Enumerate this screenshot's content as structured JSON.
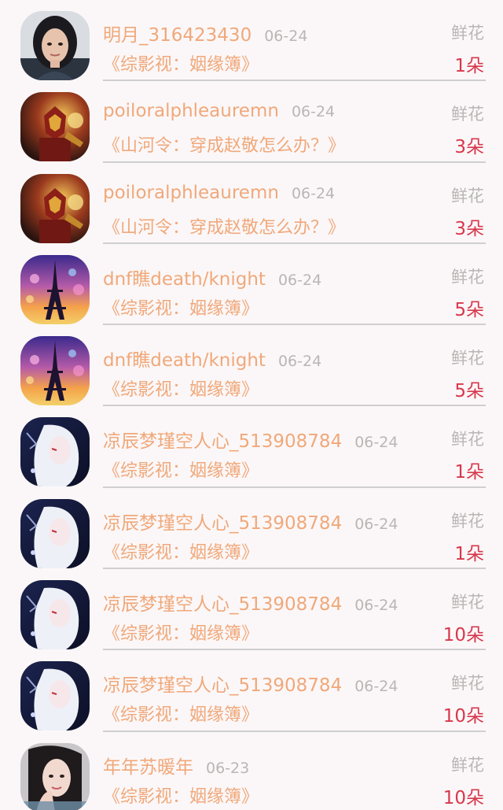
{
  "rows": [
    {
      "user": "明月_316423430",
      "date": "06-24",
      "gift": "鲜花",
      "book": "《综影视：姻缘簿》",
      "count": "1朵",
      "avatar": "woman-portrait"
    },
    {
      "user": "poiloralphleauremn",
      "date": "06-24",
      "gift": "鲜花",
      "book": "《山河令：穿成赵敬怎么办？》",
      "count": "3朵",
      "avatar": "armored-hero"
    },
    {
      "user": "poiloralphleauremn",
      "date": "06-24",
      "gift": "鲜花",
      "book": "《山河令：穿成赵敬怎么办？》",
      "count": "3朵",
      "avatar": "armored-hero"
    },
    {
      "user": "dnf瞧death/knight",
      "date": "06-24",
      "gift": "鲜花",
      "book": "《综影视：姻缘簿》",
      "count": "5朵",
      "avatar": "eiffel-tower"
    },
    {
      "user": "dnf瞧death/knight",
      "date": "06-24",
      "gift": "鲜花",
      "book": "《综影视：姻缘簿》",
      "count": "5朵",
      "avatar": "eiffel-tower"
    },
    {
      "user": "凉辰梦瑾空人心_513908784",
      "date": "06-24",
      "gift": "鲜花",
      "book": "《综影视：姻缘簿》",
      "count": "1朵",
      "avatar": "anime-white-hair"
    },
    {
      "user": "凉辰梦瑾空人心_513908784",
      "date": "06-24",
      "gift": "鲜花",
      "book": "《综影视：姻缘簿》",
      "count": "1朵",
      "avatar": "anime-white-hair"
    },
    {
      "user": "凉辰梦瑾空人心_513908784",
      "date": "06-24",
      "gift": "鲜花",
      "book": "《综影视：姻缘簿》",
      "count": "10朵",
      "avatar": "anime-white-hair"
    },
    {
      "user": "凉辰梦瑾空人心_513908784",
      "date": "06-24",
      "gift": "鲜花",
      "book": "《综影视：姻缘簿》",
      "count": "10朵",
      "avatar": "anime-white-hair"
    },
    {
      "user": "年年苏暖年",
      "date": "06-23",
      "gift": "鲜花",
      "book": "《综影视：姻缘簿》",
      "count": "10朵",
      "avatar": "woman-hand-portrait"
    }
  ]
}
